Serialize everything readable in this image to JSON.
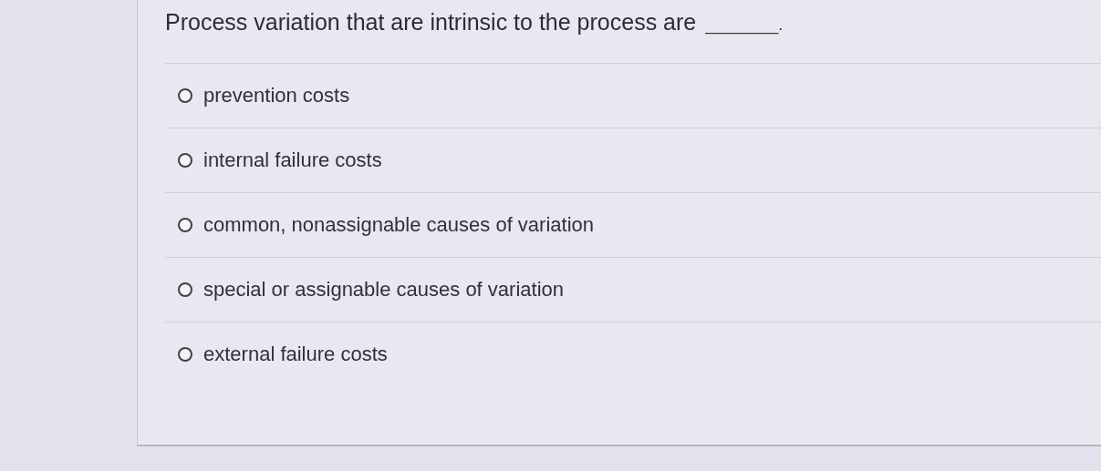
{
  "question": {
    "text": "Process variation that are intrinsic to the process are",
    "blank": "________."
  },
  "options": [
    {
      "label": "prevention costs",
      "selected": false
    },
    {
      "label": "internal failure costs",
      "selected": false
    },
    {
      "label": "common, nonassignable causes of variation",
      "selected": false
    },
    {
      "label": "special or assignable causes of variation",
      "selected": false
    },
    {
      "label": "external failure costs",
      "selected": false
    }
  ]
}
